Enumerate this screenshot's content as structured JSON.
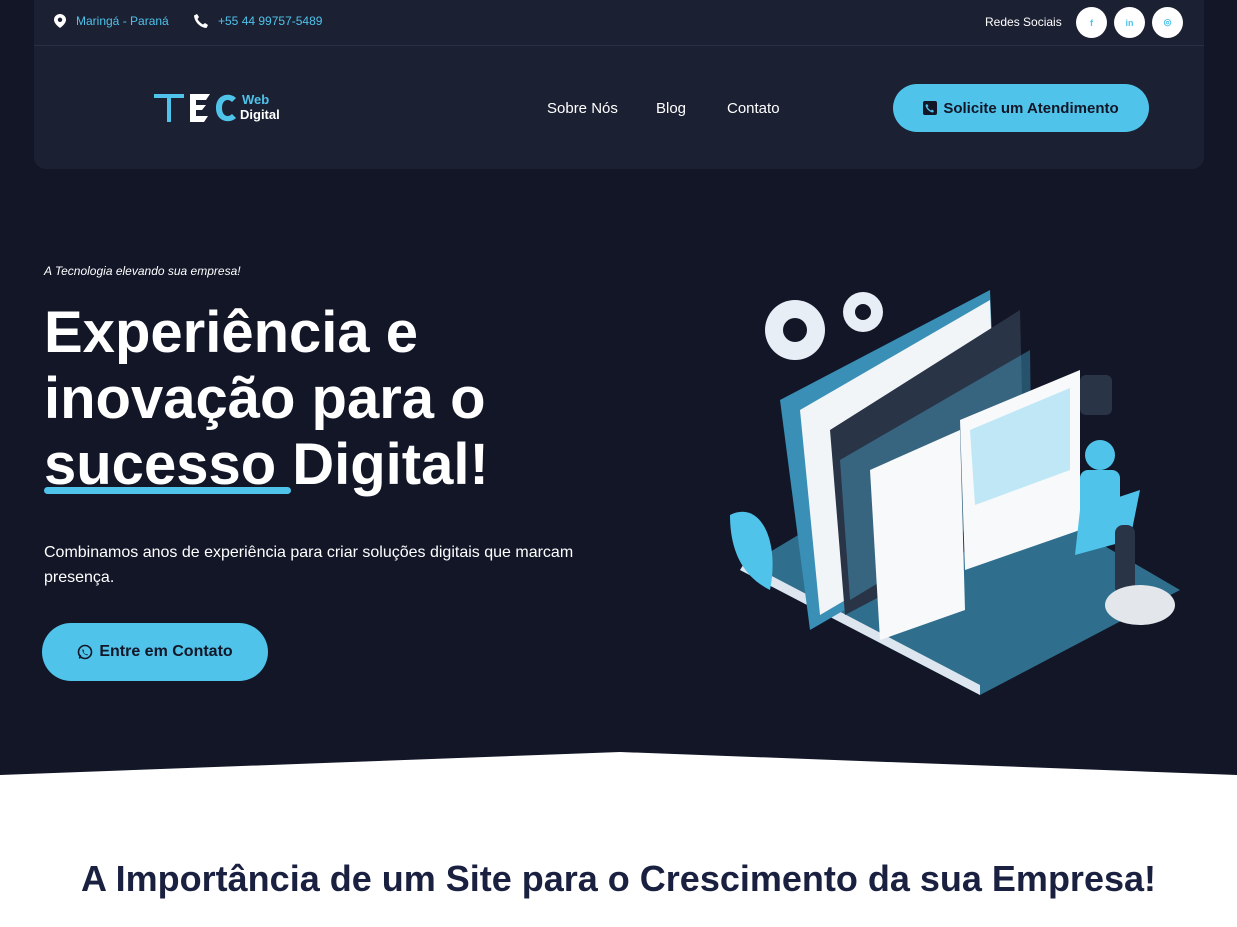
{
  "topbar": {
    "location": "Maringá - Paraná",
    "phone": "+55 44 99757-5489",
    "social_label": "Redes Sociais",
    "social_icons": [
      "facebook-icon",
      "linkedin-icon",
      "instagram-icon"
    ]
  },
  "header": {
    "logo_text_main": "TEC",
    "logo_text_web": "Web",
    "logo_text_digital": "Digital",
    "nav": [
      "Sobre Nós",
      "Blog",
      "Contato"
    ],
    "cta_label": "Solicite um Atendimento"
  },
  "hero": {
    "tagline": "A Tecnologia elevando sua empresa!",
    "headline_1": "Experiência e",
    "headline_2": "inovação para o",
    "headline_3": "sucesso Digital!",
    "description": "Combinamos anos de experiência para criar soluções digitais que marcam presença.",
    "button_label": "Entre em Contato"
  },
  "section": {
    "title": "A Importância de um Site para o Crescimento da sua Empresa!"
  },
  "colors": {
    "background": "#121627",
    "panel": "#1c2033",
    "accent": "#4fc3ea",
    "title_dark": "#1a2140"
  }
}
